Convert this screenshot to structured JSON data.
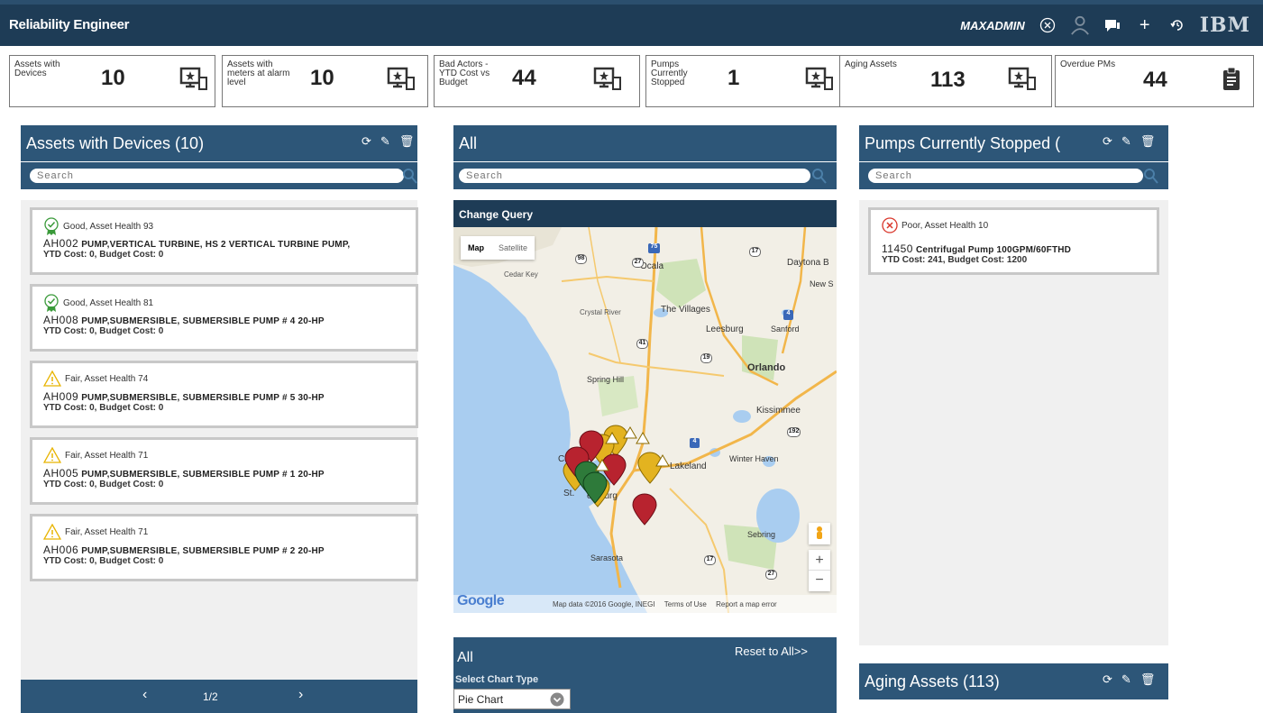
{
  "app": {
    "title": "Reliability Engineer",
    "user": "MAXADMIN",
    "brand": "IBM"
  },
  "kpis": [
    {
      "label": "Assets with Devices",
      "value": "10",
      "icon": "monitor-star-icon"
    },
    {
      "label": "Assets with meters at alarm level",
      "value": "10",
      "icon": "monitor-star-icon"
    },
    {
      "label": "Bad Actors - YTD Cost vs Budget",
      "value": "44",
      "icon": "monitor-star-icon"
    },
    {
      "label": "Pumps Currently Stopped",
      "value": "1",
      "icon": "monitor-star-icon"
    },
    {
      "label": "Aging Assets",
      "value": "113",
      "icon": "monitor-star-icon"
    },
    {
      "label": "Overdue PMs",
      "value": "44",
      "icon": "clipboard-icon"
    }
  ],
  "left_panel": {
    "title": "Assets with Devices (10)",
    "search_placeholder": "Search",
    "cards": [
      {
        "status": "Good, Asset Health 93",
        "level": "good",
        "code": "AH002",
        "desc": "PUMP,VERTICAL TURBINE, HS 2 VERTICAL TURBINE PUMP,",
        "cost": "YTD Cost: 0, Budget Cost: 0"
      },
      {
        "status": "Good, Asset Health 81",
        "level": "good",
        "code": "AH008",
        "desc": "PUMP,SUBMERSIBLE,  SUBMERSIBLE PUMP # 4 20-HP",
        "cost": "YTD Cost: 0, Budget Cost: 0"
      },
      {
        "status": "Fair, Asset Health 74",
        "level": "fair",
        "code": "AH009",
        "desc": "PUMP,SUBMERSIBLE,  SUBMERSIBLE PUMP # 5 30-HP",
        "cost": "YTD Cost: 0, Budget Cost: 0"
      },
      {
        "status": "Fair, Asset Health 71",
        "level": "fair",
        "code": "AH005",
        "desc": "PUMP,SUBMERSIBLE,  SUBMERSIBLE PUMP # 1 20-HP",
        "cost": "YTD Cost: 0, Budget Cost: 0"
      },
      {
        "status": "Fair, Asset Health 71",
        "level": "fair",
        "code": "AH006",
        "desc": "PUMP,SUBMERSIBLE,  SUBMERSIBLE PUMP # 2 20-HP",
        "cost": "YTD Cost: 0, Budget Cost: 0"
      }
    ],
    "pager": {
      "prev": "‹",
      "page": "1/2",
      "next": "›"
    }
  },
  "middle_panel": {
    "title": "All",
    "search_placeholder": "Search",
    "change_query": "Change Query",
    "map": {
      "tab_map": "Map",
      "tab_satellite": "Satellite",
      "attribution": "Map data ©2016 Google, INEGI",
      "terms": "Terms of Use",
      "report": "Report a map error",
      "logo": "Google",
      "zoom_in": "+",
      "zoom_out": "−",
      "places": [
        "Cedar Key",
        "Ocala",
        "Daytona B",
        "New S",
        "Crystal River",
        "The Villages",
        "Leesburg",
        "Sanford",
        "Orlando",
        "Spring Hill",
        "Kissimmee",
        "Clea",
        "Lakeland",
        "Winter Haven",
        "St.",
        "ersburg",
        "Sebring",
        "Sarasota"
      ],
      "roads": [
        "75",
        "98",
        "27",
        "17",
        "4",
        "41",
        "19",
        "4",
        "192",
        "17",
        "27"
      ]
    },
    "chart": {
      "title": "All",
      "reset": "Reset to All>>",
      "select_label": "Select Chart Type",
      "select_value": "Pie Chart"
    }
  },
  "right_panel": {
    "title": "Pumps Currently Stopped (",
    "search_placeholder": "Search",
    "cards": [
      {
        "status": "Poor, Asset Health 10",
        "level": "poor",
        "code": "11450",
        "desc": "Centrifugal Pump 100GPM/60FTHD",
        "cost": "YTD Cost: 241, Budget Cost: 1200"
      }
    ]
  },
  "aging_panel": {
    "title": "Aging Assets (113)"
  },
  "colors": {
    "topbar": "#1e3c56",
    "panel_header": "#2d5678",
    "good": "#3a9a3a",
    "fair": "#e8b400",
    "poor": "#d9362b"
  }
}
